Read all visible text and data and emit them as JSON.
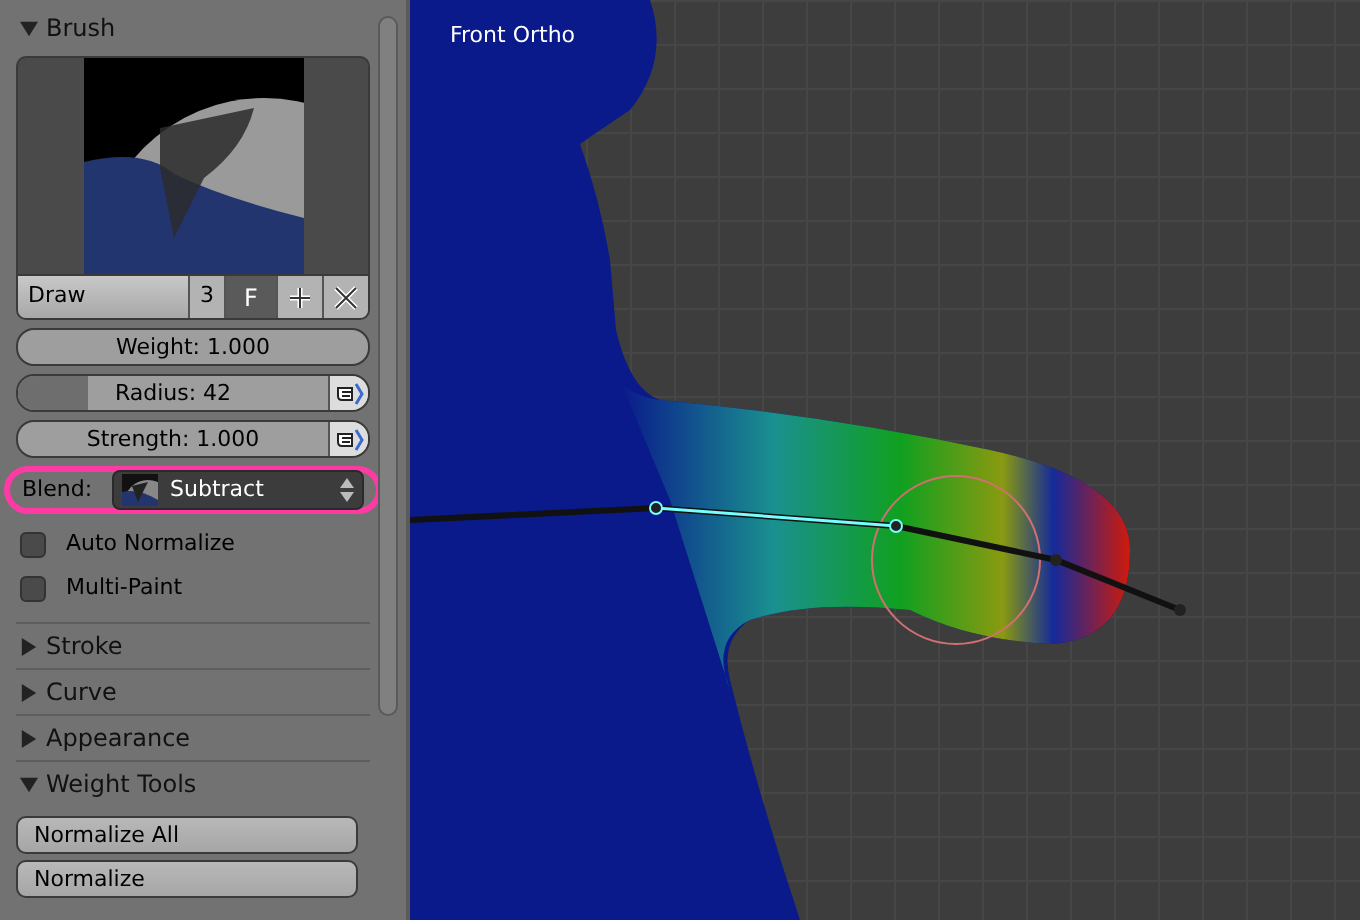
{
  "tool_panel": {
    "brush": {
      "title": "Brush",
      "expanded": true,
      "datablock": {
        "name": "Draw",
        "users": "3",
        "fake_user": "F"
      },
      "fields": [
        {
          "kind": "number",
          "label": "Weight: 1.000"
        },
        {
          "kind": "slider",
          "label": "Radius: 42",
          "level": 0.2,
          "pressure": true
        },
        {
          "kind": "number",
          "label": "Strength: 1.000",
          "pressure": true
        }
      ],
      "blend": {
        "label": "Blend:",
        "value": "Subtract",
        "highlighted": true
      },
      "options": [
        {
          "label": "Auto Normalize",
          "checked": false
        },
        {
          "label": "Multi-Paint",
          "checked": false
        }
      ]
    },
    "sections": [
      {
        "title": "Stroke",
        "expanded": false
      },
      {
        "title": "Curve",
        "expanded": false
      },
      {
        "title": "Appearance",
        "expanded": false
      },
      {
        "title": "Weight Tools",
        "expanded": true
      }
    ],
    "weight_tools": [
      "Normalize All",
      "Normalize"
    ]
  },
  "viewport": {
    "title": "Front Ortho"
  }
}
